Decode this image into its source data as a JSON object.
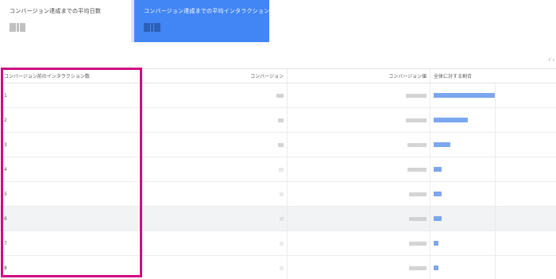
{
  "metrics": {
    "days": {
      "label": "コンバージョン達成までの平均日数"
    },
    "interactions": {
      "label": "コンバージョン達成までの平均インタラクション数"
    }
  },
  "table": {
    "headers": {
      "label": "コンバージョン前のインタラクション数",
      "conversions": "コンバージョン",
      "value": "コンバージョン値",
      "share": "全体に対する割合"
    },
    "rows": [
      {
        "label": "1",
        "share_pct": 72
      },
      {
        "label": "2",
        "share_pct": 39
      },
      {
        "label": "3",
        "share_pct": 18
      },
      {
        "label": "4",
        "share_pct": 8
      },
      {
        "label": "5",
        "share_pct": 8
      },
      {
        "label": "6",
        "share_pct": 8
      },
      {
        "label": "7",
        "share_pct": 3
      },
      {
        "label": "8",
        "share_pct": 3
      }
    ],
    "highlighted_row": 6
  },
  "colors": {
    "selected_tab": "#4285f4",
    "bar": "#7aa7ef",
    "frame": "#d10a84"
  }
}
